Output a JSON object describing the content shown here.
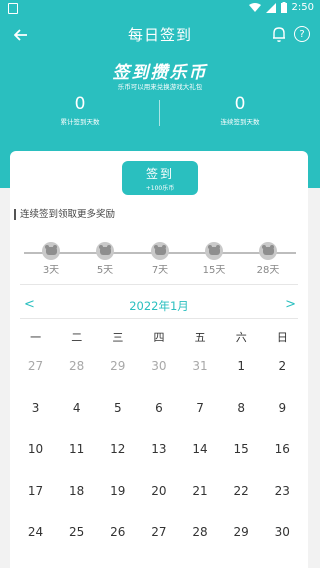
{
  "status": {
    "time": "2:50"
  },
  "appbar": {
    "title": "每日签到",
    "help_glyph": "?"
  },
  "banner": {
    "slogan": "签到攒乐币",
    "subslogan": "乐币可以用来兑换游戏大礼包"
  },
  "stats": [
    {
      "value": "0",
      "label": "累计签到天数"
    },
    {
      "value": "0",
      "label": "连续签到天数"
    }
  ],
  "signin": {
    "label": "签到",
    "reward": "+100乐币"
  },
  "streak": {
    "title": "连续签到领取更多奖励",
    "milestones": [
      "3天",
      "5天",
      "7天",
      "15天",
      "28天"
    ]
  },
  "calendar": {
    "prev": "<",
    "next": ">",
    "month": "2022年1月",
    "weekdays": [
      "一",
      "二",
      "三",
      "四",
      "五",
      "六",
      "日"
    ],
    "weeks": [
      [
        {
          "d": "27",
          "o": true
        },
        {
          "d": "28",
          "o": true
        },
        {
          "d": "29",
          "o": true
        },
        {
          "d": "30",
          "o": true
        },
        {
          "d": "31",
          "o": true
        },
        {
          "d": "1",
          "o": false
        },
        {
          "d": "2",
          "o": false
        }
      ],
      [
        {
          "d": "3",
          "o": false
        },
        {
          "d": "4",
          "o": false
        },
        {
          "d": "5",
          "o": false
        },
        {
          "d": "6",
          "o": false
        },
        {
          "d": "7",
          "o": false
        },
        {
          "d": "8",
          "o": false
        },
        {
          "d": "9",
          "o": false
        }
      ],
      [
        {
          "d": "10",
          "o": false
        },
        {
          "d": "11",
          "o": false
        },
        {
          "d": "12",
          "o": false
        },
        {
          "d": "13",
          "o": false
        },
        {
          "d": "14",
          "o": false
        },
        {
          "d": "15",
          "o": false
        },
        {
          "d": "16",
          "o": false
        }
      ],
      [
        {
          "d": "17",
          "o": false
        },
        {
          "d": "18",
          "o": false
        },
        {
          "d": "19",
          "o": false
        },
        {
          "d": "20",
          "o": false
        },
        {
          "d": "21",
          "o": false
        },
        {
          "d": "22",
          "o": false
        },
        {
          "d": "23",
          "o": false
        }
      ],
      [
        {
          "d": "24",
          "o": false
        },
        {
          "d": "25",
          "o": false
        },
        {
          "d": "26",
          "o": false
        },
        {
          "d": "27",
          "o": false
        },
        {
          "d": "28",
          "o": false
        },
        {
          "d": "29",
          "o": false
        },
        {
          "d": "30",
          "o": false
        }
      ]
    ]
  },
  "colors": {
    "accent": "#2abfbf",
    "muted": "#a8a8a8"
  }
}
